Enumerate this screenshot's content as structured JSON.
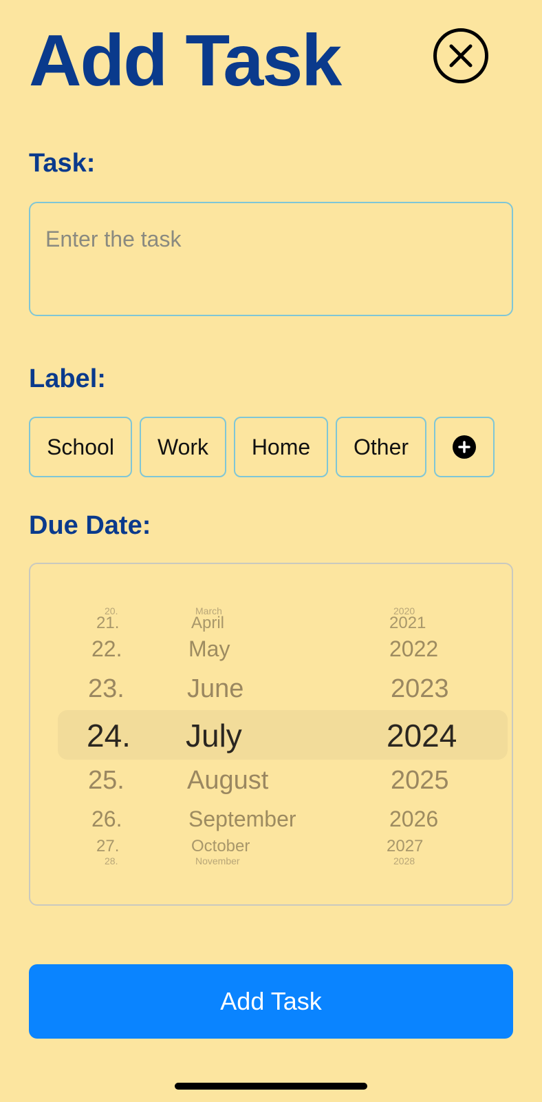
{
  "header": {
    "title": "Add Task",
    "close_icon": "close-circle-icon"
  },
  "task": {
    "label": "Task:",
    "placeholder": "Enter the task",
    "value": ""
  },
  "label_section": {
    "label": "Label:",
    "chips": [
      "School",
      "Work",
      "Home",
      "Other"
    ],
    "add_icon": "plus-circle-icon"
  },
  "due_date": {
    "label": "Due Date:",
    "days": [
      "20.",
      "21.",
      "22.",
      "23.",
      "24.",
      "25.",
      "26.",
      "27.",
      "28."
    ],
    "months": [
      "March",
      "April",
      "May",
      "June",
      "July",
      "August",
      "September",
      "October",
      "November"
    ],
    "years": [
      "2020",
      "2021",
      "2022",
      "2023",
      "2024",
      "2025",
      "2026",
      "2027",
      "2028"
    ],
    "selected": {
      "day": "24.",
      "month": "July",
      "year": "2024"
    }
  },
  "submit": {
    "label": "Add Task"
  },
  "colors": {
    "background": "#fce59f",
    "title": "#0a3a8c",
    "button": "#0a84ff",
    "border": "#7fc6d6"
  }
}
